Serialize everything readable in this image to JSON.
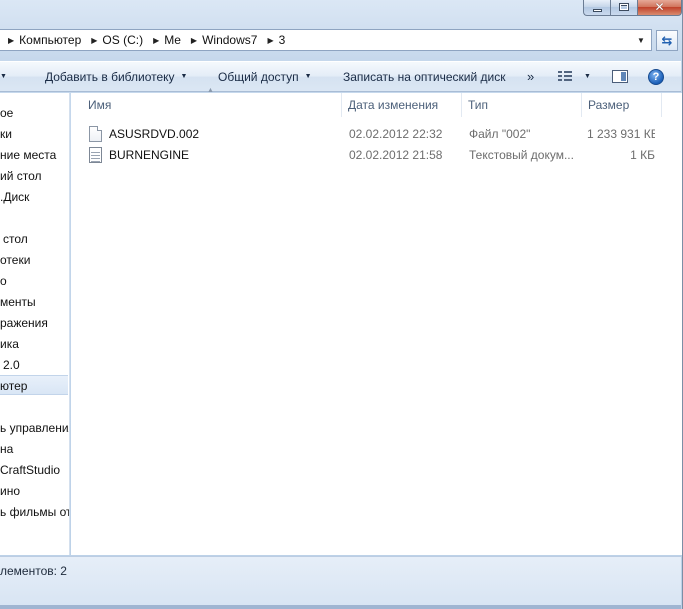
{
  "address": {
    "crumbs": [
      "Компьютер",
      "OS (C:)",
      "Me",
      "Windows7",
      "3"
    ]
  },
  "toolbar": {
    "add_to_library": "Добавить в библиотеку",
    "sharing": "Общий доступ",
    "burn": "Записать на оптический диск",
    "more": "»"
  },
  "nav": {
    "items": [
      "ое",
      "ки",
      "ние места",
      "ий стол",
      ".Диск",
      "стол",
      "отеки",
      "о",
      "менты",
      "ражения",
      "ика",
      "2.0",
      "ютер",
      "ь управления",
      "на",
      "CraftStudio",
      "ино",
      "ь фильмы от"
    ]
  },
  "columns": {
    "name": "Имя",
    "date": "Дата изменения",
    "type": "Тип",
    "size": "Размер"
  },
  "files": [
    {
      "name": "ASUSRDVD.002",
      "date": "02.02.2012 22:32",
      "type": "Файл \"002\"",
      "size": "1 233 931 КБ",
      "icon": "file-icon"
    },
    {
      "name": "BURNENGINE",
      "date": "02.02.2012 21:58",
      "type": "Текстовый докум...",
      "size": "1 КБ",
      "icon": "text-document-icon"
    }
  ],
  "status": {
    "text": "лементов: 2"
  }
}
